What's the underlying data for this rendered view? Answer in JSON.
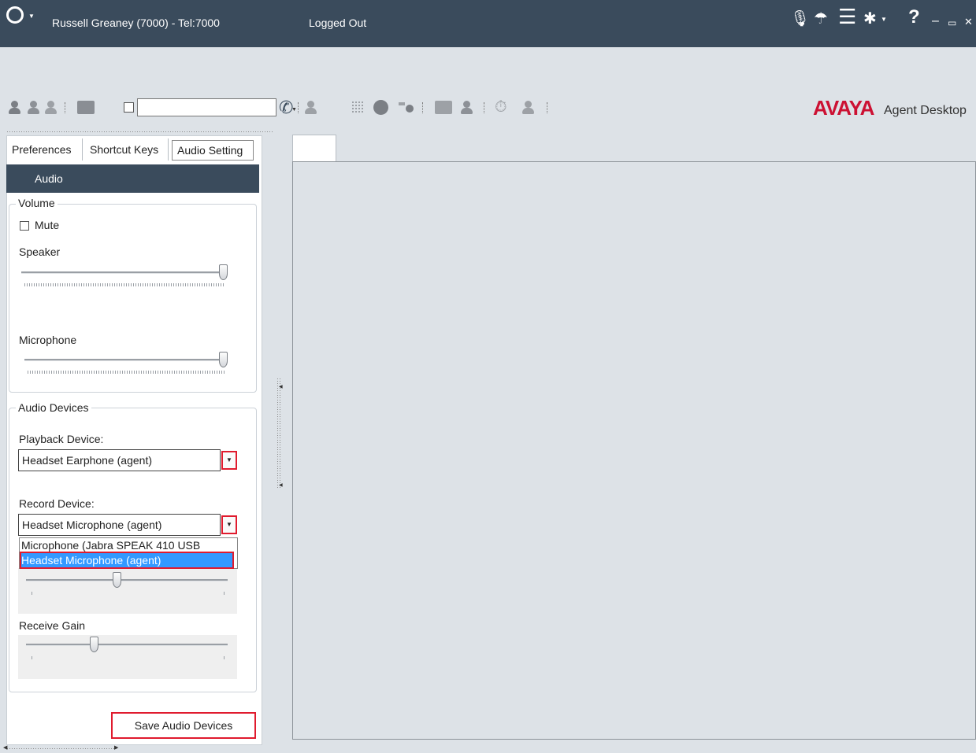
{
  "titlebar": {
    "agent": "Russell Greaney (7000) - Tel:7000",
    "state": "Logged Out",
    "icons": [
      "microphone-icon",
      "headset-status-icon",
      "menu-icon",
      "settings-gear-icon",
      "help-icon",
      "minimize-icon",
      "maximize-icon",
      "close-icon"
    ]
  },
  "toolbar": {
    "dial_value": "",
    "brand": "AVAYA",
    "brand_sub": "Agent Desktop"
  },
  "tabs": [
    "Preferences",
    "Shortcut Keys",
    "Audio Setting"
  ],
  "audio_header": "Audio",
  "volume": {
    "legend": "Volume",
    "mute_label": "Mute",
    "mute_checked": false,
    "speaker_label": "Speaker",
    "speaker_level": 1.0,
    "microphone_label": "Microphone",
    "microphone_level": 1.0
  },
  "devices": {
    "legend": "Audio Devices",
    "playback_label": "Playback Device:",
    "playback_value": "Headset Earphone (agent)",
    "record_label": "Record Device:",
    "record_value": "Headset Microphone (agent)",
    "record_options": [
      "Microphone (Jabra SPEAK 410 USB",
      "Headset Microphone (agent)"
    ],
    "record_selected_index": 1,
    "transmit_gain_level": 0.45,
    "receive_gain_label": "Receive Gain",
    "receive_gain_level": 0.33
  },
  "save_label": "Save Audio Devices"
}
